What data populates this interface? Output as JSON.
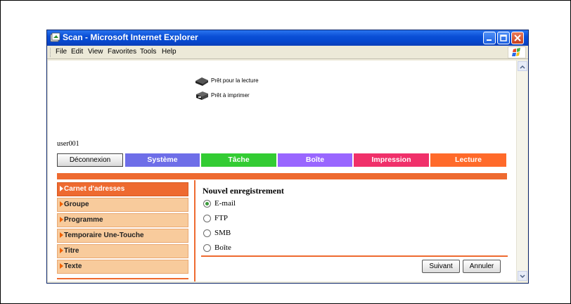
{
  "window": {
    "title": "Scan - Microsoft Internet Explorer"
  },
  "menubar": {
    "items": [
      "File",
      "Edit",
      "View",
      "Favorites",
      "Tools",
      "Help"
    ]
  },
  "status": {
    "scan_ready": "Prêt pour la lecture",
    "print_ready": "Prêt à imprimer"
  },
  "user": {
    "name": "user001"
  },
  "nav": {
    "logout_label": "Déconnexion",
    "tabs": [
      {
        "label": "Système",
        "color": "#6e6ee8"
      },
      {
        "label": "Tâche",
        "color": "#33cc33"
      },
      {
        "label": "Boîte",
        "color": "#9966ff"
      },
      {
        "label": "Impression",
        "color": "#f0306a"
      },
      {
        "label": "Lecture",
        "color": "#ff6a2a"
      }
    ]
  },
  "sidebar": {
    "items": [
      {
        "label": "Carnet d'adresses",
        "active": true
      },
      {
        "label": "Groupe",
        "active": false
      },
      {
        "label": "Programme",
        "active": false
      },
      {
        "label": "Temporaire Une-Touche",
        "active": false
      },
      {
        "label": "Titre",
        "active": false
      },
      {
        "label": "Texte",
        "active": false
      }
    ]
  },
  "form": {
    "title": "Nouvel enregistrement",
    "options": [
      {
        "label": "E-mail",
        "checked": true
      },
      {
        "label": "FTP",
        "checked": false
      },
      {
        "label": "SMB",
        "checked": false
      },
      {
        "label": "Boîte",
        "checked": false
      }
    ],
    "next_label": "Suivant",
    "cancel_label": "Annuler"
  },
  "colors": {
    "accent": "#ee6a30",
    "sidebar_bg": "#f8cb9c",
    "titlebar": "#0a4fd6"
  }
}
